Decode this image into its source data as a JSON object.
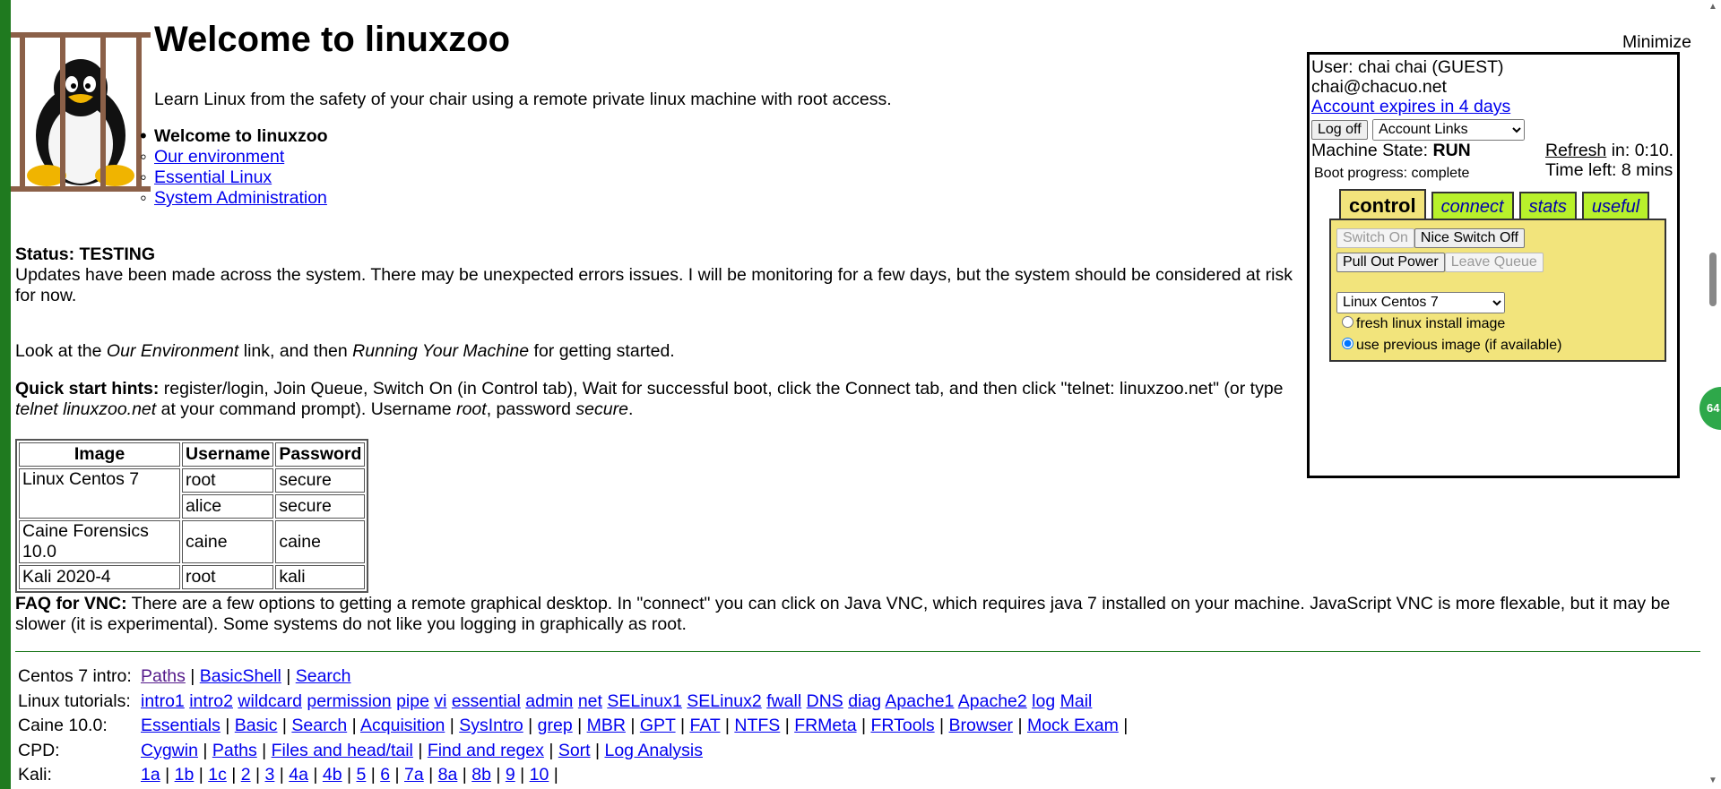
{
  "header": {
    "title": "Welcome to linuxzoo",
    "intro": "Learn Linux from the safety of your chair using a remote private linux machine with root access.",
    "welcome_items": [
      {
        "label": "Welcome to linuxzoo",
        "link": false
      },
      {
        "label": "Our environment",
        "link": true
      },
      {
        "label": "Essential Linux",
        "link": true
      },
      {
        "label": "System Administration",
        "link": true
      }
    ]
  },
  "status": {
    "heading": "Status: TESTING",
    "text": "Updates have been made across the system. There may be unexpected errors issues. I will be monitoring for a few days, but the system should be considered at risk for now."
  },
  "look": {
    "pre": "Look at the ",
    "em1": "Our Environment",
    "mid": " link, and then ",
    "em2": "Running Your Machine",
    "post": " for getting started."
  },
  "hints": {
    "label": "Quick start hints:",
    "text1": " register/login, Join Queue, Switch On (in Control tab), Wait for successful boot, click the Connect tab, and then click \"telnet: linuxzoo.net\" (or type ",
    "em1": "telnet linuxzoo.net",
    "text2": " at your command prompt). Username ",
    "em2": "root",
    "text3": ", password ",
    "em3": "secure",
    "text4": "."
  },
  "logins_table": {
    "headers": [
      "Image",
      "Username",
      "Password"
    ],
    "rows": [
      {
        "image": "Linux Centos 7",
        "username": "root",
        "password": "secure"
      },
      {
        "image": "",
        "username": "alice",
        "password": "secure"
      },
      {
        "image": "Caine Forensics 10.0",
        "username": "caine",
        "password": "caine"
      },
      {
        "image": "Kali 2020-4",
        "username": "root",
        "password": "kali"
      }
    ]
  },
  "faq": {
    "label": "FAQ for VNC:",
    "text": " There are a few options to getting a remote graphical desktop. In \"connect\" you can click on Java VNC, which requires java 7 installed on your machine. JavaScript VNC is more flexable, but it may be slower (it is experimental). Some systems do not like you logging in graphically as root."
  },
  "link_rows": [
    {
      "label": "Centos 7 intro:",
      "sep": " | ",
      "links": [
        "Paths",
        "BasicShell",
        "Search"
      ],
      "trailing": ""
    },
    {
      "label": "Linux tutorials:",
      "sep": " ",
      "links": [
        "intro1",
        "intro2",
        "wildcard",
        "permission",
        "pipe",
        "vi",
        "essential",
        "admin",
        "net",
        "SELinux1",
        "SELinux2",
        "fwall",
        "DNS",
        "diag",
        "Apache1",
        "Apache2",
        "log",
        "Mail"
      ],
      "trailing": ""
    },
    {
      "label": "Caine 10.0:",
      "sep": " | ",
      "links": [
        "Essentials",
        "Basic",
        "Search",
        "Acquisition",
        "SysIntro",
        "grep",
        "MBR",
        "GPT",
        "FAT",
        "NTFS",
        "FRMeta",
        "FRTools",
        "Browser",
        "Mock Exam"
      ],
      "trailing": " |"
    },
    {
      "label": "CPD:",
      "sep": " | ",
      "links": [
        "Cygwin",
        "Paths",
        "Files and head/tail",
        "Find and regex",
        "Sort",
        "Log Analysis"
      ],
      "trailing": ""
    },
    {
      "label": "Kali:",
      "sep": " | ",
      "links": [
        "1a",
        "1b",
        "1c",
        "2",
        "3",
        "4a",
        "4b",
        "5",
        "6",
        "7a",
        "8a",
        "8b",
        "9",
        "10"
      ],
      "trailing": " |"
    }
  ],
  "panel": {
    "minimize": "Minimize",
    "user_line": "User: chai chai (GUEST)",
    "email": "chai@chacuo.net",
    "expires": "Account expires in 4 days",
    "logoff": "Log off",
    "account_links": "Account Links",
    "machine_state_label": "Machine State: ",
    "machine_state": "RUN",
    "refresh_link": "Refresh",
    "refresh_in": " in: 0:10.",
    "time_left": "Time left: 8 mins",
    "boot_progress": "Boot progress: complete",
    "tabs": [
      "control",
      "connect",
      "stats",
      "useful"
    ],
    "switch_on": "Switch On",
    "nice_switch_off": "Nice Switch Off",
    "pull_out_power": "Pull Out Power",
    "leave_queue": "Leave Queue",
    "image_select": "Linux Centos 7",
    "radio_fresh": "fresh linux install image",
    "radio_previous": "use previous image (if available)"
  },
  "bubble": "64",
  "colors": {
    "left_bar": "#1f7a1f",
    "tab_active": "#f2e47c",
    "tab_inactive": "#b8f12b"
  }
}
